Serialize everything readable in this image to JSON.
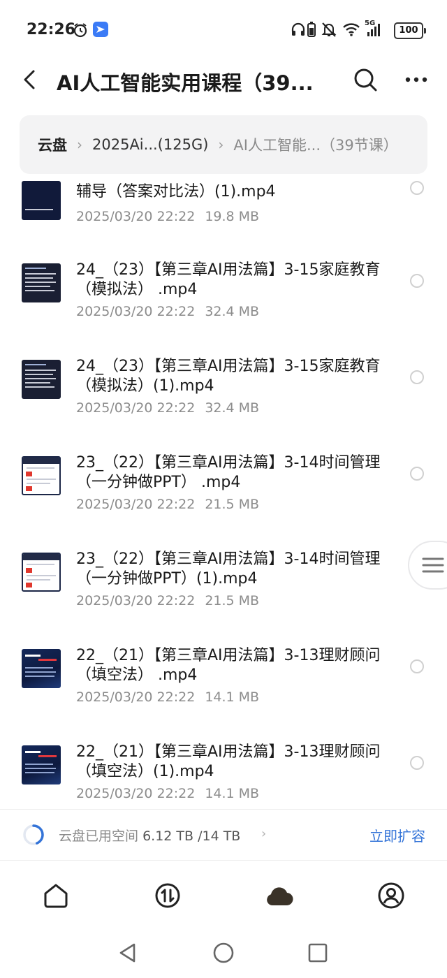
{
  "status_bar": {
    "time": "22:26",
    "network": "5G",
    "battery": "100"
  },
  "header": {
    "title": "AI人工智能实用课程（39..."
  },
  "breadcrumb": {
    "items": [
      "云盘",
      "2025Ai...(125G)",
      "AI人工智能...（39节课）"
    ]
  },
  "files": [
    {
      "name": "辅导（答案对比法）(1).mp4",
      "date": "2025/03/20 22:22",
      "size": "19.8 MB",
      "thumb": "dark"
    },
    {
      "name": "24_（23）【第三章AI用法篇】3-15家庭教育（模拟法） .mp4",
      "date": "2025/03/20 22:22",
      "size": "32.4 MB",
      "thumb": "doc"
    },
    {
      "name": "24_（23）【第三章AI用法篇】3-15家庭教育（模拟法）(1).mp4",
      "date": "2025/03/20 22:22",
      "size": "32.4 MB",
      "thumb": "doc"
    },
    {
      "name": "23_（22）【第三章AI用法篇】3-14时间管理（一分钟做PPT） .mp4",
      "date": "2025/03/20 22:22",
      "size": "21.5 MB",
      "thumb": "white"
    },
    {
      "name": "23_（22）【第三章AI用法篇】3-14时间管理（一分钟做PPT）(1).mp4",
      "date": "2025/03/20 22:22",
      "size": "21.5 MB",
      "thumb": "white"
    },
    {
      "name": "22_（21）【第三章AI用法篇】3-13理财顾问（填空法） .mp4",
      "date": "2025/03/20 22:22",
      "size": "14.1 MB",
      "thumb": "ai"
    },
    {
      "name": "22_（21）【第三章AI用法篇】3-13理财顾问（填空法）(1).mp4",
      "date": "2025/03/20 22:22",
      "size": "14.1 MB",
      "thumb": "ai"
    }
  ],
  "storage": {
    "label": "云盘已用空间",
    "value": "6.12 TB /14 TB",
    "used_fraction": 0.437,
    "action": "立即扩容"
  },
  "colors": {
    "accent": "#3474d8",
    "text_primary": "#1a1a1a",
    "text_secondary": "#8c8c8c",
    "breadcrumb_bg": "#f3f3f4"
  },
  "bottom_nav": {
    "items": [
      "home-icon",
      "transfer-icon",
      "cloud-icon",
      "profile-icon"
    ],
    "active": "cloud-icon"
  }
}
